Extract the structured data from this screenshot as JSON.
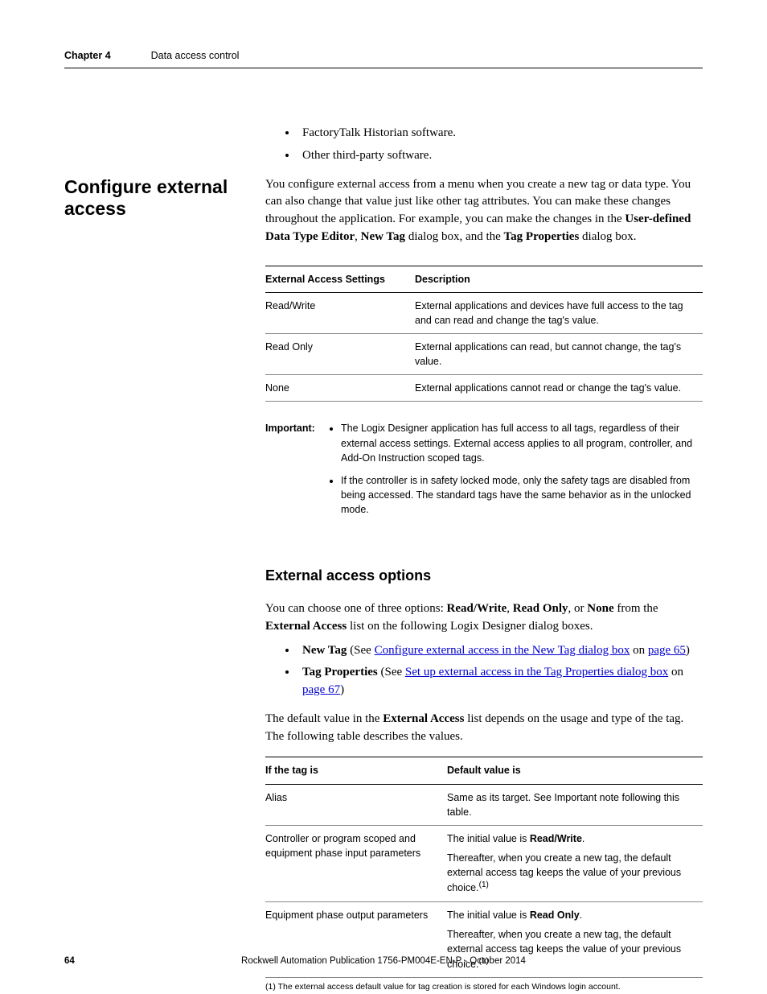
{
  "header": {
    "chapter_label": "Chapter 4",
    "chapter_title": "Data access control"
  },
  "intro_bullets": [
    "FactoryTalk Historian software.",
    "Other third-party software."
  ],
  "side_heading": "Configure external access",
  "intro_para": {
    "pre": "You configure external access from a menu when you create a new tag or data type. You can also change that value just like other tag attributes. You can make these changes throughout the application. For example, you can make the changes in the ",
    "b1": "User-defined Data Type Editor",
    "mid1": ", ",
    "b2": "New Tag",
    "mid2": " dialog box, and the ",
    "b3": "Tag Properties",
    "post": " dialog box."
  },
  "table1": {
    "head": [
      "External Access Settings",
      "Description"
    ],
    "rows": [
      [
        "Read/Write",
        "External applications and devices have full access to the tag and can read and change the tag's value."
      ],
      [
        "Read Only",
        "External applications can read, but cannot change, the tag's value."
      ],
      [
        "None",
        "External applications cannot read or change the tag's value."
      ]
    ]
  },
  "important": {
    "label": "Important:",
    "items": [
      "The Logix Designer application has full access to all tags, regardless of their external access settings. External access applies to all program, controller, and Add-On Instruction scoped tags.",
      "If the controller is in safety locked mode, only the safety tags are disabled from being accessed. The standard tags have the same behavior as in the unlocked mode."
    ]
  },
  "subhead": "External access options",
  "options_para": {
    "pre": "You can choose one of three options: ",
    "b1": "Read/Write",
    "mid1": ", ",
    "b2": "Read Only",
    "mid2": ", or ",
    "b3": "None",
    "mid3": " from the ",
    "b4": "External Access",
    "post": " list on the following Logix Designer dialog boxes."
  },
  "option_bullets": {
    "item1": {
      "b": "New Tag",
      "pre": " (See ",
      "link": "Configure external access in the New Tag dialog box",
      "mid": " on ",
      "page": "page 65",
      "post": ")"
    },
    "item2": {
      "b": "Tag Properties",
      "pre": " (See ",
      "link": "Set up external access in the Tag Properties dialog box",
      "mid": " on ",
      "page": "page 67",
      "post": ")"
    }
  },
  "default_para": {
    "pre": "The default value in the ",
    "b": "External Access",
    "post": " list depends on the usage and type of the tag. The following table describes the values."
  },
  "table2": {
    "head": [
      "If the tag is",
      "Default value is"
    ],
    "rows": [
      {
        "c1": "Alias",
        "c2_plain": "Same as its target. See Important note following this table."
      },
      {
        "c1": "Controller or program scoped and equipment phase input parameters",
        "c2_line1_pre": "The initial value is ",
        "c2_line1_b": "Read/Write",
        "c2_line1_post": ".",
        "c2_line2": "Thereafter, when you create a new tag, the default external access tag keeps the value of your previous choice.",
        "c2_sup": "(1)"
      },
      {
        "c1": "Equipment phase output parameters",
        "c2_line1_pre": "The initial value is ",
        "c2_line1_b": "Read Only",
        "c2_line1_post": ".",
        "c2_line2": "Thereafter, when you create a new tag, the default external access tag keeps the value of your previous choice.",
        "c2_sup": "(1)"
      }
    ]
  },
  "footnote": "(1)    The external access default value for tag creation is stored for each Windows login account.",
  "footer": {
    "page": "64",
    "pub": "Rockwell Automation Publication 1756-PM004E-EN-P - October 2014"
  }
}
